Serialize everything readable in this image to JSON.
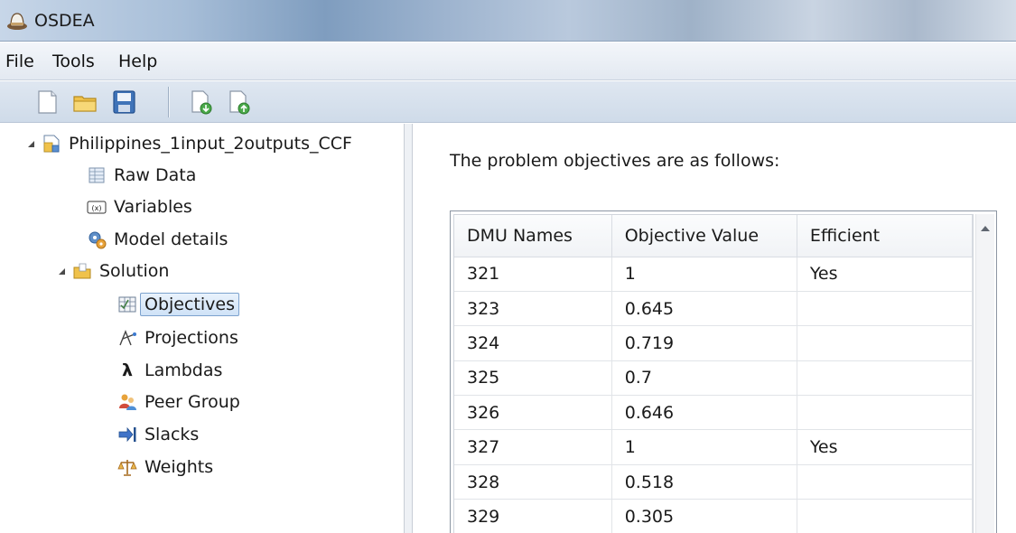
{
  "window": {
    "title": "OSDEA",
    "icon": "hat-app-icon"
  },
  "menu": [
    {
      "label": "File"
    },
    {
      "label": "Tools"
    },
    {
      "label": "Help"
    }
  ],
  "toolbar": {
    "buttons": [
      {
        "icon": "new-file-icon"
      },
      {
        "icon": "open-folder-icon"
      },
      {
        "icon": "save-icon"
      },
      {
        "icon": "import-icon"
      },
      {
        "icon": "export-icon"
      }
    ]
  },
  "tree": {
    "root": "Philippines_1input_2outputs_CCF",
    "items": [
      {
        "label": "Raw Data",
        "icon": "table-icon"
      },
      {
        "label": "Variables",
        "icon": "variable-icon"
      },
      {
        "label": "Model details",
        "icon": "gears-icon"
      }
    ],
    "solution": {
      "label": "Solution",
      "icon": "folder-icon",
      "children": [
        {
          "label": "Objectives",
          "icon": "objectives-icon",
          "selected": true
        },
        {
          "label": "Projections",
          "icon": "projections-icon"
        },
        {
          "label": "Lambdas",
          "icon": "lambda-icon"
        },
        {
          "label": "Peer Group",
          "icon": "people-icon"
        },
        {
          "label": "Slacks",
          "icon": "arrow-bar-icon"
        },
        {
          "label": "Weights",
          "icon": "scales-icon"
        }
      ]
    }
  },
  "content": {
    "prompt": "The problem objectives are as follows:",
    "table": {
      "columns": [
        "DMU Names",
        "Objective Value",
        "Efficient"
      ],
      "rows": [
        [
          "321",
          "1",
          "Yes"
        ],
        [
          "323",
          "0.645",
          ""
        ],
        [
          "324",
          "0.719",
          ""
        ],
        [
          "325",
          "0.7",
          ""
        ],
        [
          "326",
          "0.646",
          ""
        ],
        [
          "327",
          "1",
          "Yes"
        ],
        [
          "328",
          "0.518",
          ""
        ],
        [
          "329",
          "0.305",
          ""
        ]
      ]
    }
  }
}
